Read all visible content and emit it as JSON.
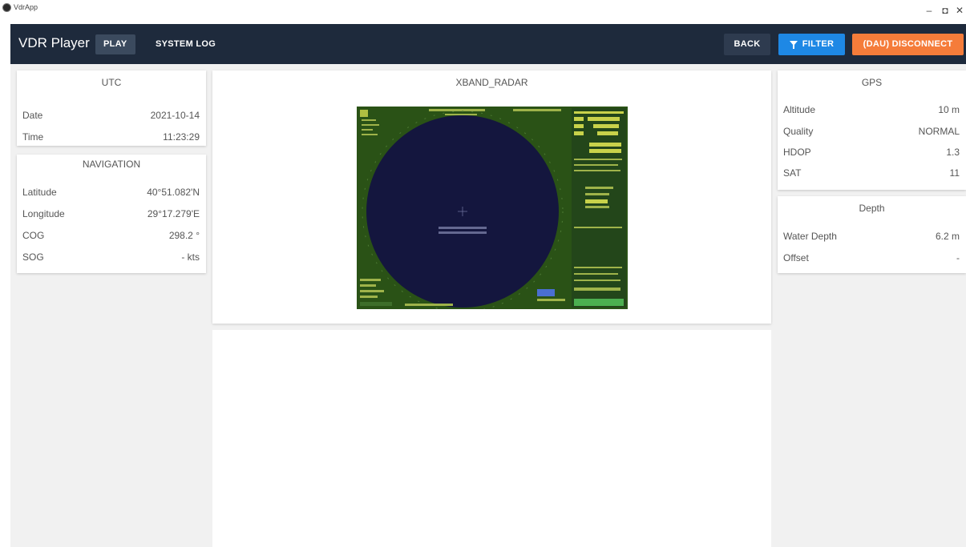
{
  "window": {
    "title": "VdrApp",
    "controls": {
      "minimize": "–",
      "maximize": "◘",
      "close": "✕"
    }
  },
  "header": {
    "brand": "VDR Player",
    "nav": {
      "play": "PLAY",
      "system_log": "SYSTEM LOG"
    },
    "actions": {
      "back": "BACK",
      "filter": "FILTER",
      "disconnect": "(DAU) DISCONNECT"
    }
  },
  "colors": {
    "header_bg": "#1e2a3c",
    "filter_button": "#1e88e5",
    "disconnect_button": "#f57c3a",
    "radar_sweep": "#14163e",
    "radar_background": "#2a5216"
  },
  "utc": {
    "title": "UTC",
    "rows": [
      {
        "label": "Date",
        "value": "2021-10-14"
      },
      {
        "label": "Time",
        "value": "11:23:29"
      }
    ]
  },
  "navigation": {
    "title": "NAVIGATION",
    "rows": [
      {
        "label": "Latitude",
        "value": "40°51.082'N"
      },
      {
        "label": "Longitude",
        "value": "29°17.279'E"
      },
      {
        "label": "COG",
        "value": "298.2 °"
      },
      {
        "label": "SOG",
        "value": "- kts"
      }
    ]
  },
  "radar": {
    "title": "XBAND_RADAR",
    "image_icon": "radar-screen-image"
  },
  "gps": {
    "title": "GPS",
    "rows": [
      {
        "label": "Altitude",
        "value": "10 m"
      },
      {
        "label": "Quality",
        "value": "NORMAL"
      },
      {
        "label": "HDOP",
        "value": "1.3"
      },
      {
        "label": "SAT",
        "value": "11"
      }
    ]
  },
  "depth": {
    "title": "Depth",
    "rows": [
      {
        "label": "Water Depth",
        "value": "6.2 m"
      },
      {
        "label": "Offset",
        "value": "-"
      }
    ]
  }
}
